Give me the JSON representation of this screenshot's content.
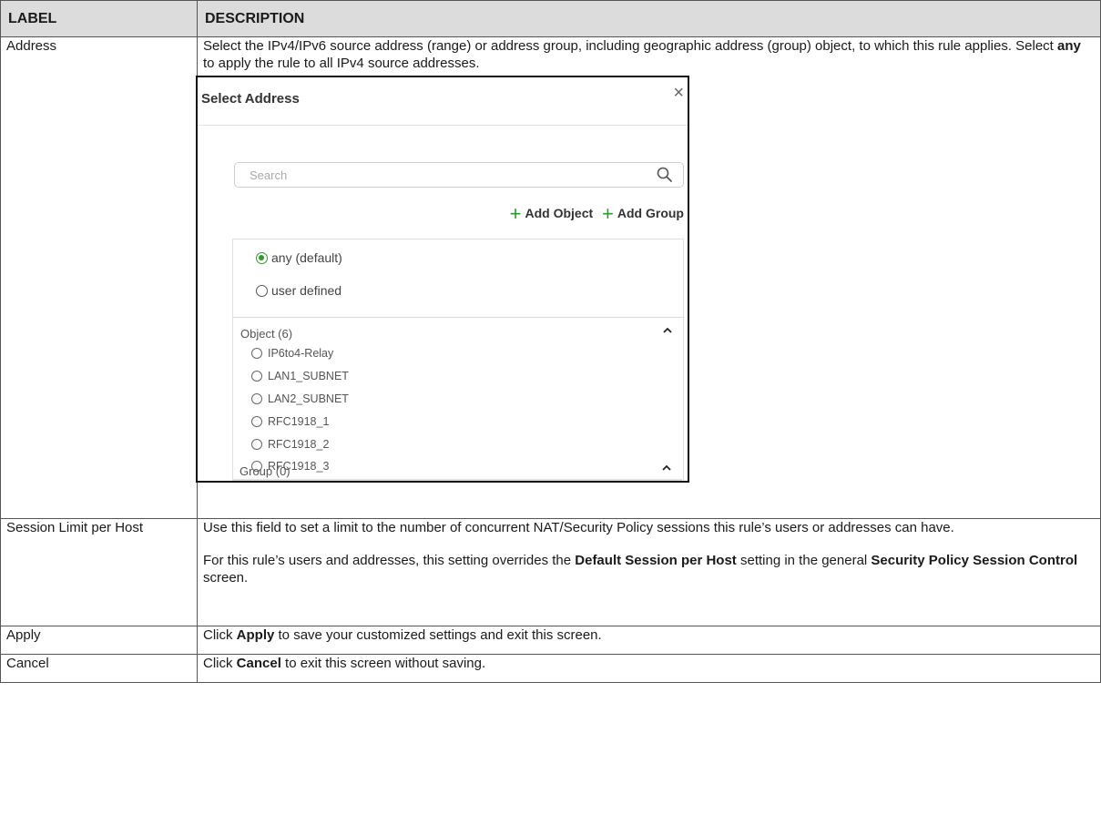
{
  "table": {
    "headers": {
      "label": "LABEL",
      "description": "DESCRIPTION"
    },
    "rows": {
      "address": {
        "label": "Address",
        "desc_1": "Select the IPv4/IPv6 source address (range) or address group, including geographic address (group) object, to which this rule applies. Select ",
        "desc_bold": "any",
        "desc_2": " to apply the rule to all IPv4 source addresses."
      },
      "session": {
        "label": "Session Limit per Host",
        "p1": "Use this field to set a limit to the number of concurrent NAT/Security Policy sessions this rule’s users or addresses can have.",
        "p2_a": "For this rule’s users and addresses, this setting overrides the ",
        "p2_b": "Default Session per Host",
        "p2_c": " setting in the general ",
        "p2_d": "Security Policy Session Control",
        "p2_e": " screen."
      },
      "apply": {
        "label": "Apply",
        "a": "Click ",
        "b": "Apply",
        "c": " to save your customized settings and exit this screen."
      },
      "cancel": {
        "label": "Cancel",
        "a": "Click ",
        "b": "Cancel",
        "c": " to exit this screen without saving."
      }
    }
  },
  "dialog": {
    "title": "Select Address",
    "close_symbol": "×",
    "search_placeholder": "Search",
    "add_object": "Add Object",
    "add_group": "Add Group",
    "plus_symbol": "+",
    "options": [
      "any (default)",
      "user defined"
    ],
    "selected_option": "any (default)",
    "object_section": "Object (6)",
    "objects": [
      "IP6to4-Relay",
      "LAN1_SUBNET",
      "LAN2_SUBNET",
      "RFC1918_1",
      "RFC1918_2",
      "RFC1918_3"
    ],
    "group_section": "Group (0)"
  },
  "colors": {
    "accent": "#2e9a2e",
    "header_bg": "#dcdcdc"
  },
  "icons": [
    "close-icon",
    "search-icon",
    "plus-icon",
    "chevron-up-icon",
    "radio-icon"
  ]
}
